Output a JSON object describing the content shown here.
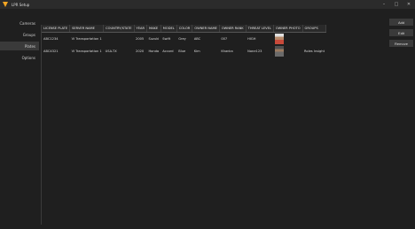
{
  "window": {
    "title": "LPR Setup",
    "controls": [
      "–",
      "□",
      "✕"
    ]
  },
  "sidebar": {
    "items": [
      {
        "label": "Cameras",
        "active": false
      },
      {
        "label": "Groups",
        "active": false
      },
      {
        "label": "Plates",
        "active": true
      },
      {
        "label": "Options",
        "active": false
      }
    ]
  },
  "table": {
    "headers": [
      "LICENSE PLATE",
      "SERVER NAME",
      "COUNTRY/STATE",
      "YEAR",
      "MAKE",
      "MODEL",
      "COLOR",
      "OWNER NAME",
      "OWNER RANK",
      "THREAT LEVEL",
      "OWNER PHOTO",
      "GROUPS"
    ],
    "rows": [
      {
        "cells": [
          "ABC1234",
          "VI Transportation 1",
          "",
          "2005",
          "Suzuki",
          "Swift",
          "Grey",
          "ABC",
          "007",
          "HIGH",
          "",
          ""
        ]
      },
      {
        "cells": [
          "ABC4321",
          "VI Transportation 1",
          "USA-TX",
          "2020",
          "Honda",
          "Accord",
          "Blue",
          "Kim",
          "Khanka",
          "None123",
          "",
          "Roles Insight"
        ]
      }
    ]
  },
  "actions": {
    "add": "Add",
    "edit": "Edit",
    "remove": "Remove"
  }
}
